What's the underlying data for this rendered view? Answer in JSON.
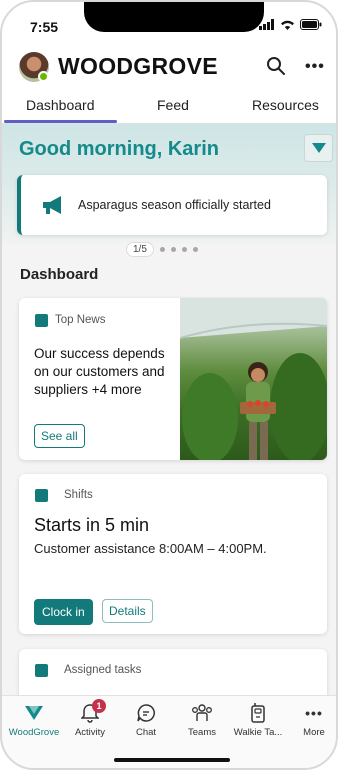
{
  "status_bar": {
    "time": "7:55"
  },
  "header": {
    "app_title": "WOODGROVE"
  },
  "tabs": [
    {
      "label": "Dashboard",
      "active": true
    },
    {
      "label": "Feed",
      "active": false
    },
    {
      "label": "Resources",
      "active": false
    }
  ],
  "hero": {
    "greeting": "Good morning, Karin"
  },
  "announcement": {
    "text": "Asparagus season officially started",
    "pager": "1/5"
  },
  "dashboard": {
    "section_title": "Dashboard",
    "top_news": {
      "label": "Top News",
      "headline": "Our success depends on our customers and suppliers +4 more",
      "see_all": "See all"
    },
    "shifts": {
      "label": "Shifts",
      "title": "Starts in 5 min",
      "detail": "Customer assistance 8:00AM – 4:00PM.",
      "clock_in": "Clock in",
      "details": "Details"
    },
    "tasks": {
      "label": "Assigned tasks"
    }
  },
  "bottom_nav": [
    {
      "label": "WoodGrove",
      "icon": "woodgrove-logo-icon",
      "active": true
    },
    {
      "label": "Activity",
      "icon": "bell-icon",
      "badge": "1"
    },
    {
      "label": "Chat",
      "icon": "chat-icon"
    },
    {
      "label": "Teams",
      "icon": "teams-icon"
    },
    {
      "label": "Walkie Ta...",
      "icon": "walkie-talkie-icon"
    },
    {
      "label": "More",
      "icon": "more-icon"
    }
  ],
  "colors": {
    "accent": "#127a7a",
    "greeting": "#148a8a",
    "badge": "#c4314b",
    "presence": "#6bb700"
  }
}
